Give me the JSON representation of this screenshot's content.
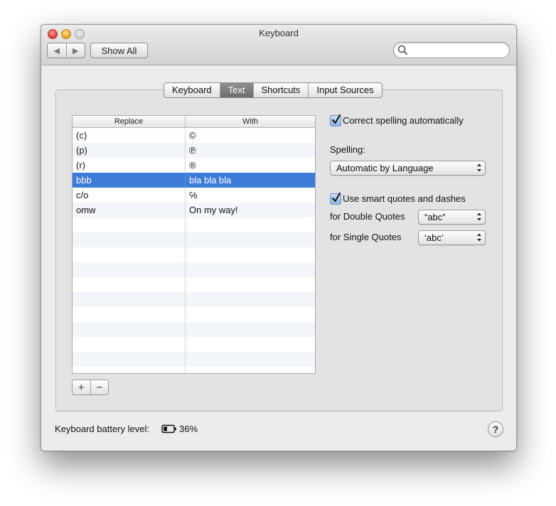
{
  "window": {
    "title": "Keyboard"
  },
  "toolbar": {
    "back_glyph": "◀",
    "forward_glyph": "▶",
    "show_all_label": "Show All",
    "search_placeholder": ""
  },
  "tabs": [
    {
      "label": "Keyboard",
      "selected": false
    },
    {
      "label": "Text",
      "selected": true
    },
    {
      "label": "Shortcuts",
      "selected": false
    },
    {
      "label": "Input Sources",
      "selected": false
    }
  ],
  "table": {
    "columns": [
      "Replace",
      "With"
    ],
    "rows": [
      {
        "replace": "(c)",
        "with": "©"
      },
      {
        "replace": "(p)",
        "with": "℗"
      },
      {
        "replace": "(r)",
        "with": "®"
      },
      {
        "replace": "bbb",
        "with": "bla bla bla",
        "selected": true
      },
      {
        "replace": "c/o",
        "with": "℅"
      },
      {
        "replace": "omw",
        "with": "On my way!"
      }
    ],
    "add_label": "+",
    "remove_label": "−"
  },
  "options": {
    "correct_spelling": {
      "label": "Correct spelling automatically",
      "checked": true
    },
    "spelling_label": "Spelling:",
    "spelling_value": "Automatic by Language",
    "smart_quotes": {
      "label": "Use smart quotes and dashes",
      "checked": true
    },
    "double_quotes_label": "for Double Quotes",
    "double_quotes_value": "“abc”",
    "single_quotes_label": "for Single Quotes",
    "single_quotes_value": "‘abc’"
  },
  "footer": {
    "battery_label": "Keyboard battery level:",
    "battery_percent": "36%",
    "help_label": "?"
  },
  "colors": {
    "selection": "#3d7bd9",
    "tab_selected": "#7a7a7a",
    "window_bg": "#ececec"
  }
}
